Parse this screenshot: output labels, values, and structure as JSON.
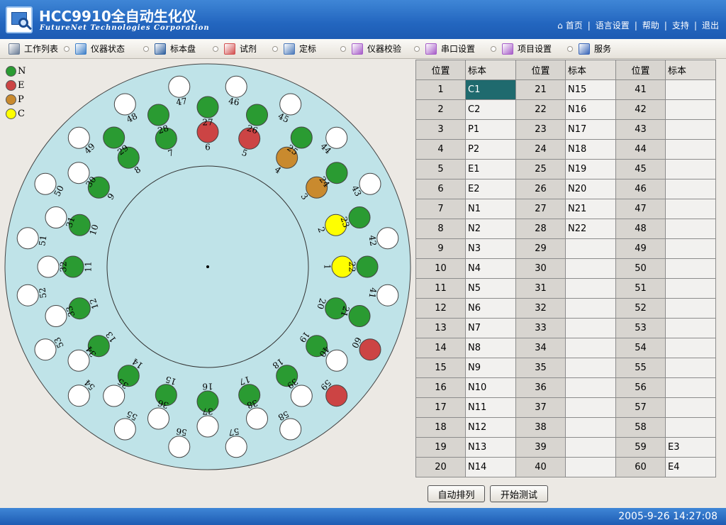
{
  "header": {
    "title": "HCC9910全自动生化仪",
    "company": "FutureNet Technologies Corporation",
    "links": [
      "首页",
      "语言设置",
      "帮助",
      "支持",
      "退出"
    ]
  },
  "toolbar": {
    "items": [
      {
        "label": "工作列表",
        "icon": "worklist-icon",
        "color": "#6b7d96"
      },
      {
        "label": "仪器状态",
        "icon": "instrument-status-icon",
        "color": "#3d7fc8"
      },
      {
        "label": "标本盘",
        "icon": "sample-tray-icon",
        "color": "#2e5f9e"
      },
      {
        "label": "试剂",
        "icon": "reagent-icon",
        "color": "#d24f4f"
      },
      {
        "label": "定标",
        "icon": "calibration-icon",
        "color": "#4a78b9"
      },
      {
        "label": "仪器校验",
        "icon": "instrument-verify-icon",
        "color": "#a65cc8"
      },
      {
        "label": "串口设置",
        "icon": "serial-port-icon",
        "color": "#a65cc8"
      },
      {
        "label": "项目设置",
        "icon": "project-settings-icon",
        "color": "#a65cc8"
      },
      {
        "label": "服务",
        "icon": "service-icon",
        "color": "#3a66b8"
      }
    ]
  },
  "legend": [
    {
      "code": "N",
      "color": "#2a9b32"
    },
    {
      "code": "E",
      "color": "#cc4444"
    },
    {
      "code": "P",
      "color": "#c98a2e"
    },
    {
      "code": "C",
      "color": "#ffff00"
    }
  ],
  "tray": {
    "positions": [
      {
        "n": 1,
        "type": "C"
      },
      {
        "n": 2,
        "type": "C"
      },
      {
        "n": 3,
        "type": "P"
      },
      {
        "n": 4,
        "type": "P"
      },
      {
        "n": 5,
        "type": "E"
      },
      {
        "n": 6,
        "type": "E"
      },
      {
        "n": 7,
        "type": "N"
      },
      {
        "n": 8,
        "type": "N"
      },
      {
        "n": 9,
        "type": "N"
      },
      {
        "n": 10,
        "type": "N"
      },
      {
        "n": 11,
        "type": "N"
      },
      {
        "n": 12,
        "type": "N"
      },
      {
        "n": 13,
        "type": "N"
      },
      {
        "n": 14,
        "type": "N"
      },
      {
        "n": 15,
        "type": "N"
      },
      {
        "n": 16,
        "type": "N"
      },
      {
        "n": 17,
        "type": "N"
      },
      {
        "n": 18,
        "type": "N"
      },
      {
        "n": 19,
        "type": "N"
      },
      {
        "n": 20,
        "type": "N"
      },
      {
        "n": 21,
        "type": "N"
      },
      {
        "n": 22,
        "type": "N"
      },
      {
        "n": 23,
        "type": "N"
      },
      {
        "n": 24,
        "type": "N"
      },
      {
        "n": 25,
        "type": "N"
      },
      {
        "n": 26,
        "type": "N"
      },
      {
        "n": 27,
        "type": "N"
      },
      {
        "n": 28,
        "type": "N"
      },
      {
        "n": 29,
        "type": "N"
      },
      {
        "n": 30,
        "type": ""
      },
      {
        "n": 31,
        "type": ""
      },
      {
        "n": 32,
        "type": ""
      },
      {
        "n": 33,
        "type": ""
      },
      {
        "n": 34,
        "type": ""
      },
      {
        "n": 35,
        "type": ""
      },
      {
        "n": 36,
        "type": ""
      },
      {
        "n": 37,
        "type": ""
      },
      {
        "n": 38,
        "type": ""
      },
      {
        "n": 39,
        "type": ""
      },
      {
        "n": 40,
        "type": ""
      },
      {
        "n": 41,
        "type": ""
      },
      {
        "n": 42,
        "type": ""
      },
      {
        "n": 43,
        "type": ""
      },
      {
        "n": 44,
        "type": ""
      },
      {
        "n": 45,
        "type": ""
      },
      {
        "n": 46,
        "type": ""
      },
      {
        "n": 47,
        "type": ""
      },
      {
        "n": 48,
        "type": ""
      },
      {
        "n": 49,
        "type": ""
      },
      {
        "n": 50,
        "type": ""
      },
      {
        "n": 51,
        "type": ""
      },
      {
        "n": 52,
        "type": ""
      },
      {
        "n": 53,
        "type": ""
      },
      {
        "n": 54,
        "type": ""
      },
      {
        "n": 55,
        "type": ""
      },
      {
        "n": 56,
        "type": ""
      },
      {
        "n": 57,
        "type": ""
      },
      {
        "n": 58,
        "type": ""
      },
      {
        "n": 59,
        "type": "E"
      },
      {
        "n": 60,
        "type": "E"
      }
    ]
  },
  "table": {
    "header_pos": "位置",
    "header_std": "标本",
    "selected": 1,
    "rows": [
      [
        "1",
        "C1",
        "21",
        "N15",
        "41",
        ""
      ],
      [
        "2",
        "C2",
        "22",
        "N16",
        "42",
        ""
      ],
      [
        "3",
        "P1",
        "23",
        "N17",
        "43",
        ""
      ],
      [
        "4",
        "P2",
        "24",
        "N18",
        "44",
        ""
      ],
      [
        "5",
        "E1",
        "25",
        "N19",
        "45",
        ""
      ],
      [
        "6",
        "E2",
        "26",
        "N20",
        "46",
        ""
      ],
      [
        "7",
        "N1",
        "27",
        "N21",
        "47",
        ""
      ],
      [
        "8",
        "N2",
        "28",
        "N22",
        "48",
        ""
      ],
      [
        "9",
        "N3",
        "29",
        "",
        "49",
        ""
      ],
      [
        "10",
        "N4",
        "30",
        "",
        "50",
        ""
      ],
      [
        "11",
        "N5",
        "31",
        "",
        "51",
        ""
      ],
      [
        "12",
        "N6",
        "32",
        "",
        "52",
        ""
      ],
      [
        "13",
        "N7",
        "33",
        "",
        "53",
        ""
      ],
      [
        "14",
        "N8",
        "34",
        "",
        "54",
        ""
      ],
      [
        "15",
        "N9",
        "35",
        "",
        "55",
        ""
      ],
      [
        "16",
        "N10",
        "36",
        "",
        "56",
        ""
      ],
      [
        "17",
        "N11",
        "37",
        "",
        "57",
        ""
      ],
      [
        "18",
        "N12",
        "38",
        "",
        "58",
        ""
      ],
      [
        "19",
        "N13",
        "39",
        "",
        "59",
        "E3"
      ],
      [
        "20",
        "N14",
        "40",
        "",
        "60",
        "E4"
      ]
    ]
  },
  "buttons": {
    "auto_arrange": "自动排列",
    "start_test": "开始测试"
  },
  "status": {
    "datetime": "2005-9-26 14:27:08"
  }
}
